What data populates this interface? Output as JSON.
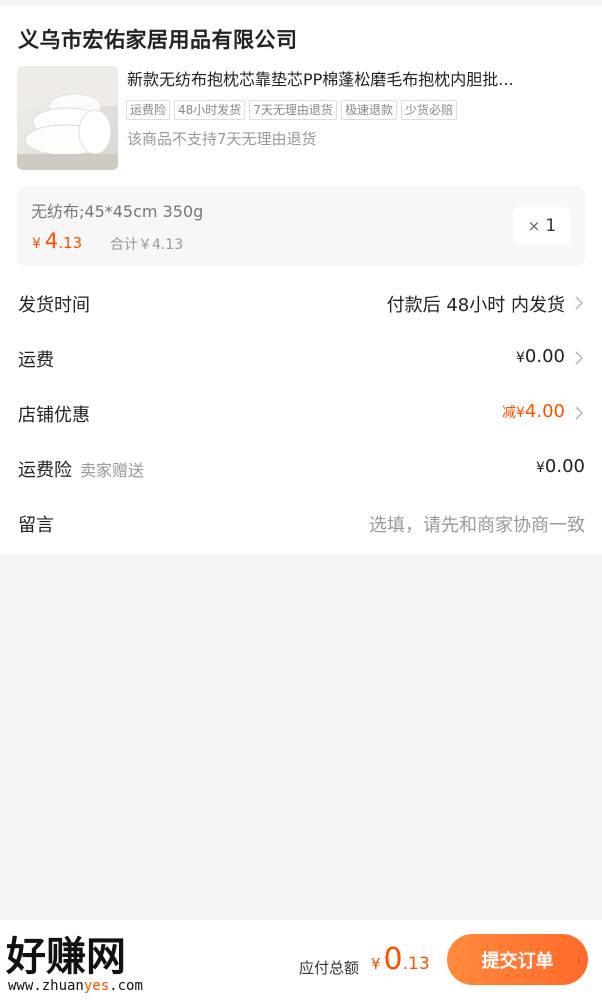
{
  "shop": {
    "name": "义乌市宏佑家居用品有限公司"
  },
  "product": {
    "title": "新款无纺布抱枕芯靠垫芯PP棉蓬松磨毛布抱枕内胆批...",
    "tags": [
      "运费险",
      "48小时发货",
      "7天无理由退货",
      "极速退款",
      "少货必赔"
    ],
    "no_return_notice": "该商品不支持7天无理由退货",
    "sku": {
      "spec": "无纺布;45*45cm 350g",
      "currency": "¥",
      "price_int": "4",
      "price_dec": ".13",
      "subtotal": "合计￥4.13",
      "qty_prefix": "×",
      "qty": "1"
    }
  },
  "rows": {
    "shipping_time": {
      "label": "发货时间",
      "prefix": "付款后 ",
      "highlight": "48小时",
      "suffix": " 内发货"
    },
    "freight": {
      "label": "运费",
      "currency": "¥",
      "value": "0.00"
    },
    "shop_discount": {
      "label": "店铺优惠",
      "prefix": "减",
      "currency": "¥",
      "value": "4.00"
    },
    "freight_insurance": {
      "label": "运费险",
      "sublabel": "卖家赠送",
      "currency": "¥",
      "value": "0.00"
    },
    "message": {
      "label": "留言",
      "placeholder": "选填，请先和商家协商一致"
    }
  },
  "bottom_bar": {
    "logo_text": "好赚网",
    "logo_url_a": "www.zhuan",
    "logo_url_b": "yes",
    "logo_url_c": ".com",
    "total_label": "应付总额",
    "currency": "¥",
    "total_int": "0",
    "total_dec": ".13",
    "submit_label": "提交订单"
  },
  "colors": {
    "accent": "#ff5000",
    "button_start": "#ff8a3d",
    "button_end": "#ff6a2a"
  }
}
